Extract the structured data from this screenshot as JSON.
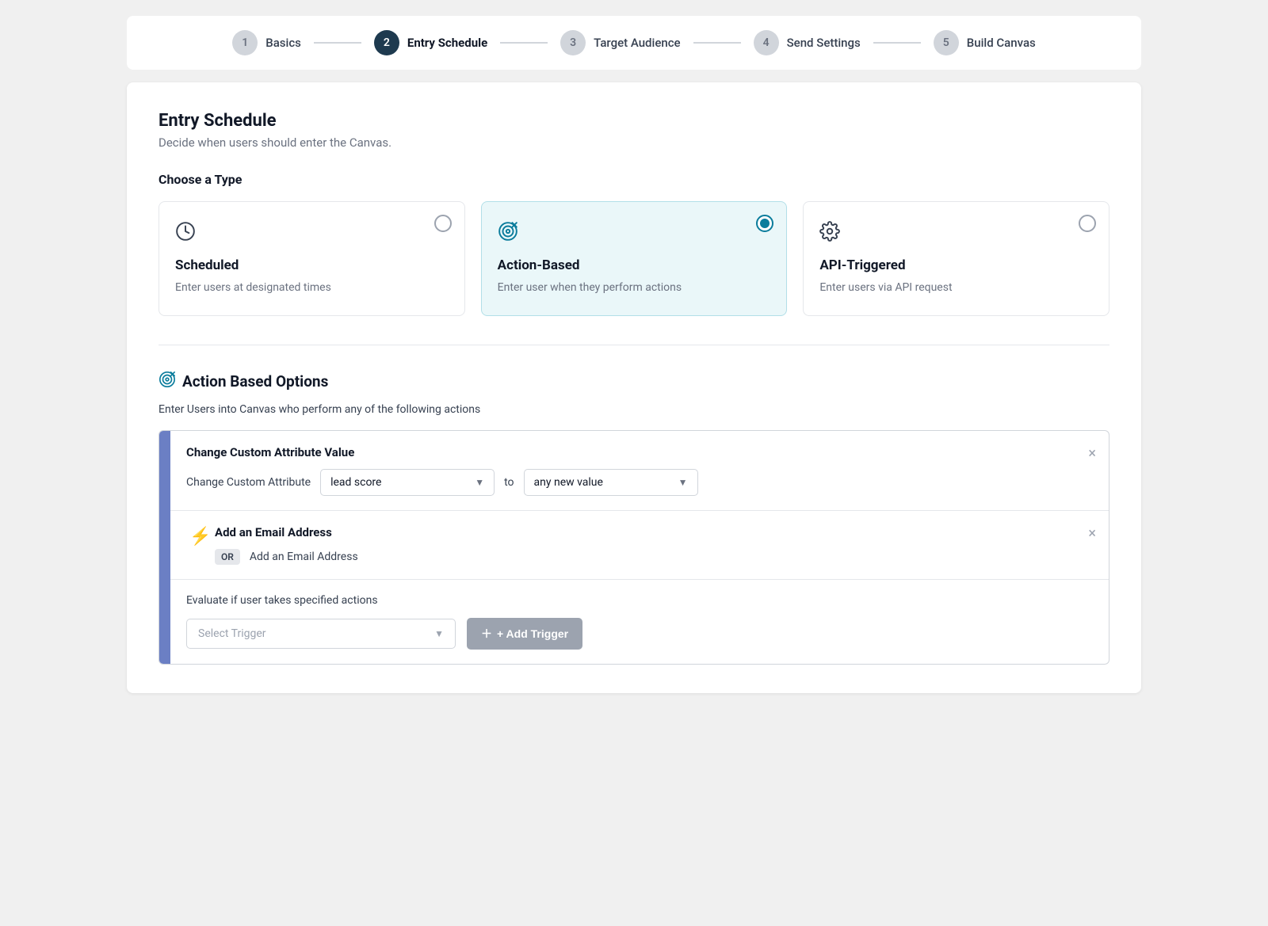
{
  "stepper": {
    "steps": [
      {
        "id": "basics",
        "num": "1",
        "label": "Basics",
        "state": "inactive"
      },
      {
        "id": "entry-schedule",
        "num": "2",
        "label": "Entry Schedule",
        "state": "active"
      },
      {
        "id": "target-audience",
        "num": "3",
        "label": "Target Audience",
        "state": "inactive"
      },
      {
        "id": "send-settings",
        "num": "4",
        "label": "Send Settings",
        "state": "inactive"
      },
      {
        "id": "build-canvas",
        "num": "5",
        "label": "Build Canvas",
        "state": "inactive"
      }
    ]
  },
  "main": {
    "title": "Entry Schedule",
    "subtitle": "Decide when users should enter the Canvas.",
    "choose_type_label": "Choose a Type",
    "type_cards": [
      {
        "id": "scheduled",
        "icon": "🕐",
        "name": "Scheduled",
        "desc": "Enter users at designated times",
        "selected": false
      },
      {
        "id": "action-based",
        "icon": "🎯",
        "name": "Action-Based",
        "desc": "Enter user when they perform actions",
        "selected": true
      },
      {
        "id": "api-triggered",
        "icon": "⚙️",
        "name": "API-Triggered",
        "desc": "Enter users via API request",
        "selected": false
      }
    ],
    "abo": {
      "title": "Action Based Options",
      "subtitle": "Enter Users into Canvas who perform any of the following actions",
      "action_rows": [
        {
          "id": "row1",
          "title": "Change Custom Attribute Value",
          "label": "Change Custom Attribute",
          "attribute_value": "lead score",
          "to_label": "to",
          "target_value": "any new value",
          "has_close": true
        },
        {
          "id": "row2",
          "title": "Add an Email Address",
          "or_badge": "OR",
          "label": "Add an Email Address",
          "has_close": true,
          "has_lightning": true
        }
      ],
      "evaluate_text": "Evaluate if user takes specified actions",
      "select_trigger_placeholder": "Select Trigger",
      "add_trigger_label": "+ Add Trigger"
    }
  }
}
